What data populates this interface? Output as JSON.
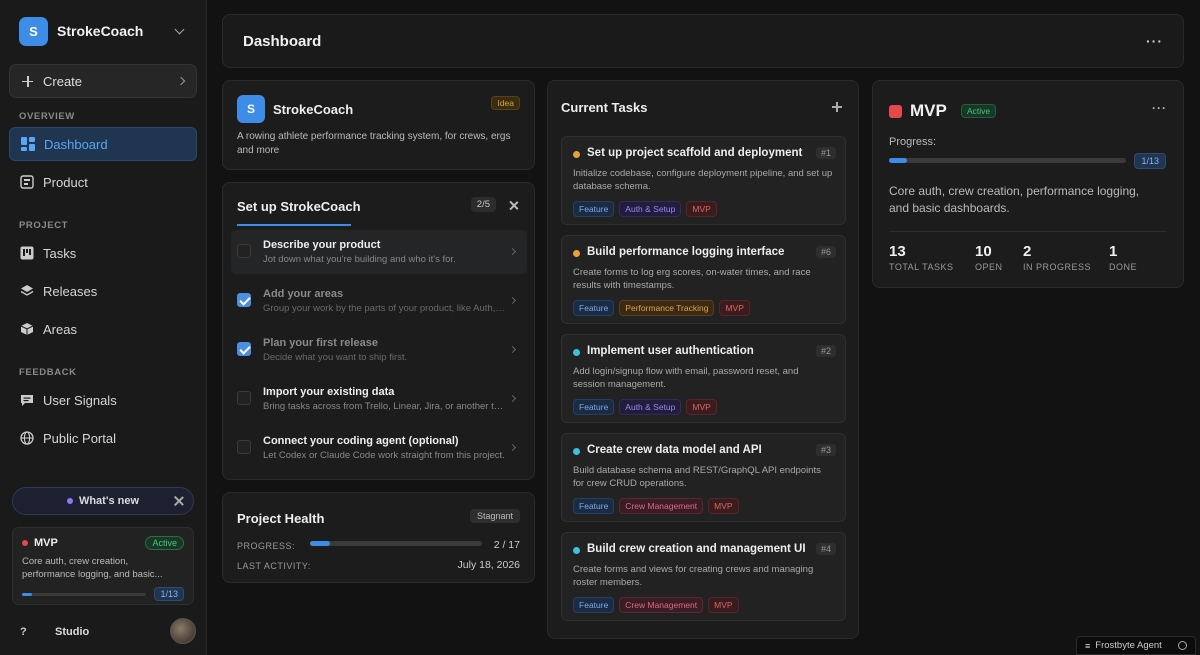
{
  "workspace": {
    "logo_letter": "S",
    "name": "StrokeCoach"
  },
  "sidebar": {
    "create_label": "Create",
    "sections": {
      "overview": "OVERVIEW",
      "project": "PROJECT",
      "feedback": "FEEDBACK"
    },
    "items": {
      "dashboard": "Dashboard",
      "product": "Product",
      "tasks": "Tasks",
      "releases": "Releases",
      "areas": "Areas",
      "user_signals": "User Signals",
      "public_portal": "Public Portal"
    },
    "whats_new": "What's new",
    "mvp_card": {
      "title": "MVP",
      "status": "Active",
      "desc": "Core auth, crew creation, performance logging, and basic...",
      "progress": 0.077,
      "count": "1/13"
    },
    "footer": {
      "help": "?",
      "studio": "Studio"
    }
  },
  "header": {
    "title": "Dashboard",
    "menu": "···"
  },
  "project_card": {
    "logo_letter": "S",
    "name": "StrokeCoach",
    "badge": "Idea",
    "description": "A rowing athlete performance tracking system, for crews, ergs and more"
  },
  "setup": {
    "title": "Set up StrokeCoach",
    "count": "2/5",
    "steps": [
      {
        "title": "Describe your product",
        "sub": "Jot down what you're building and who it's for.",
        "done": false,
        "active": true
      },
      {
        "title": "Add your areas",
        "sub": "Group your work by the parts of your product, like Auth, Billing...",
        "done": true,
        "active": false
      },
      {
        "title": "Plan your first release",
        "sub": "Decide what you want to ship first.",
        "done": true,
        "active": false
      },
      {
        "title": "Import your existing data",
        "sub": "Bring tasks across from Trello, Linear, Jira, or another tool.",
        "done": false,
        "active": false
      },
      {
        "title": "Connect your coding agent (optional)",
        "sub": "Let Codex or Claude Code work straight from this project.",
        "done": false,
        "active": false
      }
    ]
  },
  "health": {
    "title": "Project Health",
    "badge": "Stagnant",
    "progress_label": "PROGRESS:",
    "progress": 0.118,
    "progress_value": "2 / 17",
    "activity_label": "LAST ACTIVITY:",
    "activity_value": "July 18, 2026"
  },
  "tasks": {
    "title": "Current Tasks",
    "items": [
      {
        "title": "Set up project scaffold and deployment",
        "num": "#1",
        "dot": "#e8a13a",
        "desc": "Initialize codebase, configure deployment pipeline, and set up database schema.",
        "tags": [
          {
            "label": "Feature",
            "kind": "feature"
          },
          {
            "label": "Auth & Setup",
            "kind": "auth"
          },
          {
            "label": "MVP",
            "kind": "mvp"
          }
        ]
      },
      {
        "title": "Build performance logging interface",
        "num": "#6",
        "dot": "#e8a13a",
        "desc": "Create forms to log erg scores, on-water times, and race results with timestamps.",
        "tags": [
          {
            "label": "Feature",
            "kind": "feature"
          },
          {
            "label": "Performance Tracking",
            "kind": "perf"
          },
          {
            "label": "MVP",
            "kind": "mvp"
          }
        ]
      },
      {
        "title": "Implement user authentication",
        "num": "#2",
        "dot": "#3ec1e0",
        "desc": "Add login/signup flow with email, password reset, and session management.",
        "tags": [
          {
            "label": "Feature",
            "kind": "feature"
          },
          {
            "label": "Auth & Setup",
            "kind": "auth"
          },
          {
            "label": "MVP",
            "kind": "mvp"
          }
        ]
      },
      {
        "title": "Create crew data model and API",
        "num": "#3",
        "dot": "#3ec1e0",
        "desc": "Build database schema and REST/GraphQL API endpoints for crew CRUD operations.",
        "tags": [
          {
            "label": "Feature",
            "kind": "feature"
          },
          {
            "label": "Crew Management",
            "kind": "crew"
          },
          {
            "label": "MVP",
            "kind": "mvp"
          }
        ]
      },
      {
        "title": "Build crew creation and management UI",
        "num": "#4",
        "dot": "#3ec1e0",
        "desc": "Create forms and views for creating crews and managing roster members.",
        "tags": [
          {
            "label": "Feature",
            "kind": "feature"
          },
          {
            "label": "Crew Management",
            "kind": "crew"
          },
          {
            "label": "MVP",
            "kind": "mvp"
          }
        ]
      }
    ]
  },
  "release": {
    "title": "MVP",
    "status": "Active",
    "menu": "···",
    "progress_label": "Progress:",
    "progress": 0.077,
    "count": "1/13",
    "description": "Core auth, crew creation, performance logging, and basic dashboards.",
    "stats": [
      {
        "n": "13",
        "label": "TOTAL TASKS"
      },
      {
        "n": "10",
        "label": "OPEN"
      },
      {
        "n": "2",
        "label": "IN PROGRESS"
      },
      {
        "n": "1",
        "label": "DONE"
      }
    ]
  },
  "agent": {
    "label": "Frostbyte Agent"
  }
}
